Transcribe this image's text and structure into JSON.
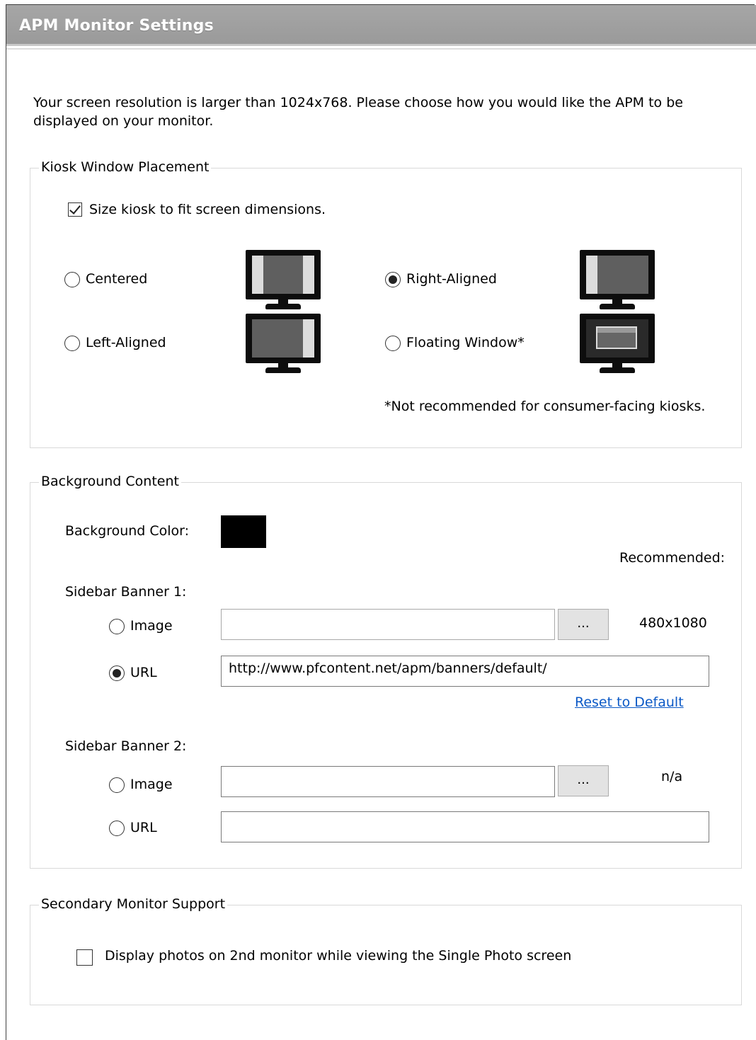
{
  "window": {
    "title": "APM Monitor Settings",
    "intro_line1": "Your screen resolution is larger than 1024x768. Please choose how you would like the APM to be",
    "intro_line2": "displayed on your monitor."
  },
  "kiosk": {
    "legend": "Kiosk Window Placement",
    "size_to_fit_label": "Size kiosk to fit screen dimensions.",
    "size_to_fit_checked": true,
    "options": [
      {
        "label": "Centered",
        "selected": false,
        "icon": "monitor-centered-icon"
      },
      {
        "label": "Right-Aligned",
        "selected": true,
        "icon": "monitor-right-aligned-icon"
      },
      {
        "label": "Left-Aligned",
        "selected": false,
        "icon": "monitor-left-aligned-icon"
      },
      {
        "label": "Floating Window*",
        "selected": false,
        "icon": "monitor-floating-window-icon"
      }
    ],
    "footnote": "*Not recommended for consumer-facing kiosks."
  },
  "background": {
    "legend": "Background Content",
    "color_label": "Background Color:",
    "color_value": "#000000",
    "recommended_label": "Recommended:",
    "banner1": {
      "label": "Sidebar Banner 1:",
      "image_label": "Image",
      "image_selected": false,
      "image_value": "",
      "browse_label": "...",
      "recommended_size": "480x1080",
      "url_label": "URL",
      "url_selected": true,
      "url_value": "http://www.pfcontent.net/apm/banners/default/",
      "reset_label": "Reset to Default"
    },
    "banner2": {
      "label": "Sidebar Banner 2:",
      "image_label": "Image",
      "image_selected": false,
      "image_value": "",
      "browse_label": "...",
      "recommended_size": "n/a",
      "url_label": "URL",
      "url_selected": false,
      "url_value": ""
    }
  },
  "secondary": {
    "legend": "Secondary Monitor Support",
    "display_photos_label": "Display photos on 2nd monitor while viewing the Single Photo screen",
    "display_photos_checked": false
  },
  "colors": {
    "title_bar": "#a0a0a0",
    "link": "#0b59c6",
    "monitor_frame": "#0d0d0d",
    "monitor_screen": "#5f5f5f",
    "monitor_panel": "#dcdcdc"
  }
}
